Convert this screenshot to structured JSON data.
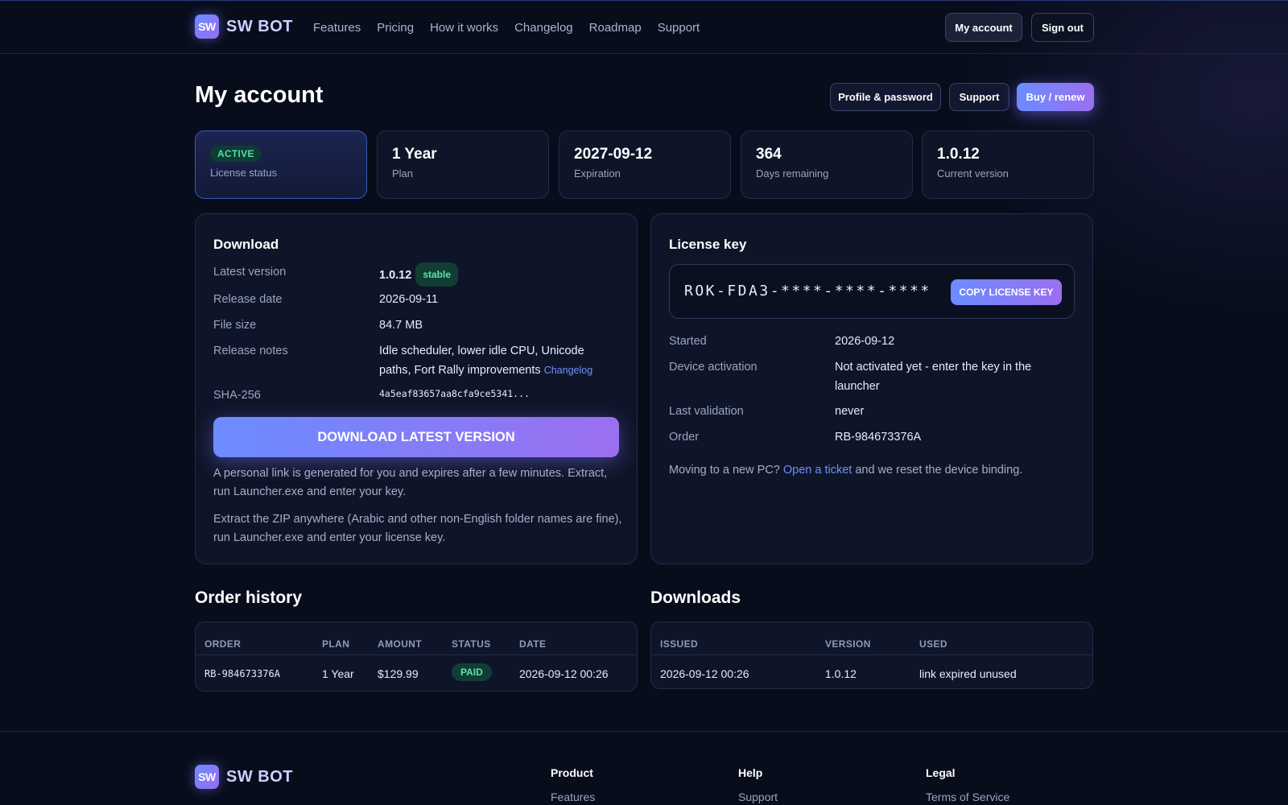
{
  "brand": {
    "logo_text": "SW",
    "name": "SW BOT"
  },
  "nav": [
    "Features",
    "Pricing",
    "How it works",
    "Changelog",
    "Roadmap",
    "Support"
  ],
  "header_buttons": {
    "my_account": "My account",
    "sign_out": "Sign out"
  },
  "page": {
    "title": "My account"
  },
  "actions": {
    "profile": "Profile & password",
    "support": "Support",
    "buy": "Buy / renew"
  },
  "stats": {
    "status": {
      "badge": "ACTIVE",
      "label": "License status"
    },
    "plan": {
      "value": "1 Year",
      "label": "Plan"
    },
    "expiration": {
      "value": "2027-09-12",
      "label": "Expiration"
    },
    "days": {
      "value": "364",
      "label": "Days remaining"
    },
    "version": {
      "value": "1.0.12",
      "label": "Current version"
    }
  },
  "download": {
    "title": "Download",
    "latest_version_label": "Latest version",
    "latest_version": "1.0.12",
    "stable_badge": "stable",
    "release_date_label": "Release date",
    "release_date": "2026-09-11",
    "file_size_label": "File size",
    "file_size": "84.7 MB",
    "release_notes_label": "Release notes",
    "release_notes": "Idle scheduler, lower idle CPU, Unicode paths, Fort Rally improvements",
    "changelog_link": "Changelog",
    "sha_label": "SHA-256",
    "sha": "4a5eaf83657aa8cfa9ce5341...",
    "button": "DOWNLOAD LATEST VERSION",
    "note1": "A personal link is generated for you and expires after a few minutes. Extract, run Launcher.exe and enter your key.",
    "note2": "Extract the ZIP anywhere (Arabic and other non-English folder names are fine), run Launcher.exe and enter your license key."
  },
  "license": {
    "title": "License key",
    "key": "ROK-FDA3-****-****-****",
    "copy_button": "COPY LICENSE KEY",
    "started_label": "Started",
    "started": "2026-09-12",
    "device_label": "Device activation",
    "device": "Not activated yet - enter the key in the launcher",
    "validation_label": "Last validation",
    "validation": "never",
    "order_label": "Order",
    "order": "RB-984673376A",
    "moving_text": "Moving to a new PC?",
    "ticket_link": "Open a ticket",
    "moving_suffix": "and we reset the device binding."
  },
  "orders": {
    "title": "Order history",
    "headers": [
      "ORDER",
      "PLAN",
      "AMOUNT",
      "STATUS",
      "DATE"
    ],
    "row": {
      "order": "RB-984673376A",
      "plan": "1 Year",
      "amount": "$129.99",
      "status": "PAID",
      "date": "2026-09-12 00:26"
    }
  },
  "downloads": {
    "title": "Downloads",
    "headers": [
      "ISSUED",
      "VERSION",
      "USED"
    ],
    "row": {
      "issued": "2026-09-12 00:26",
      "version": "1.0.12",
      "used": "link expired unused"
    }
  },
  "footer": {
    "product_title": "Product",
    "product_link": "Features",
    "help_title": "Help",
    "help_link": "Support",
    "legal_title": "Legal",
    "legal_link": "Terms of Service"
  },
  "colors": {
    "accent_start": "#6b8cff",
    "accent_end": "#9a6ff0",
    "success": "#5ee3ad",
    "background": "#080d1c"
  }
}
